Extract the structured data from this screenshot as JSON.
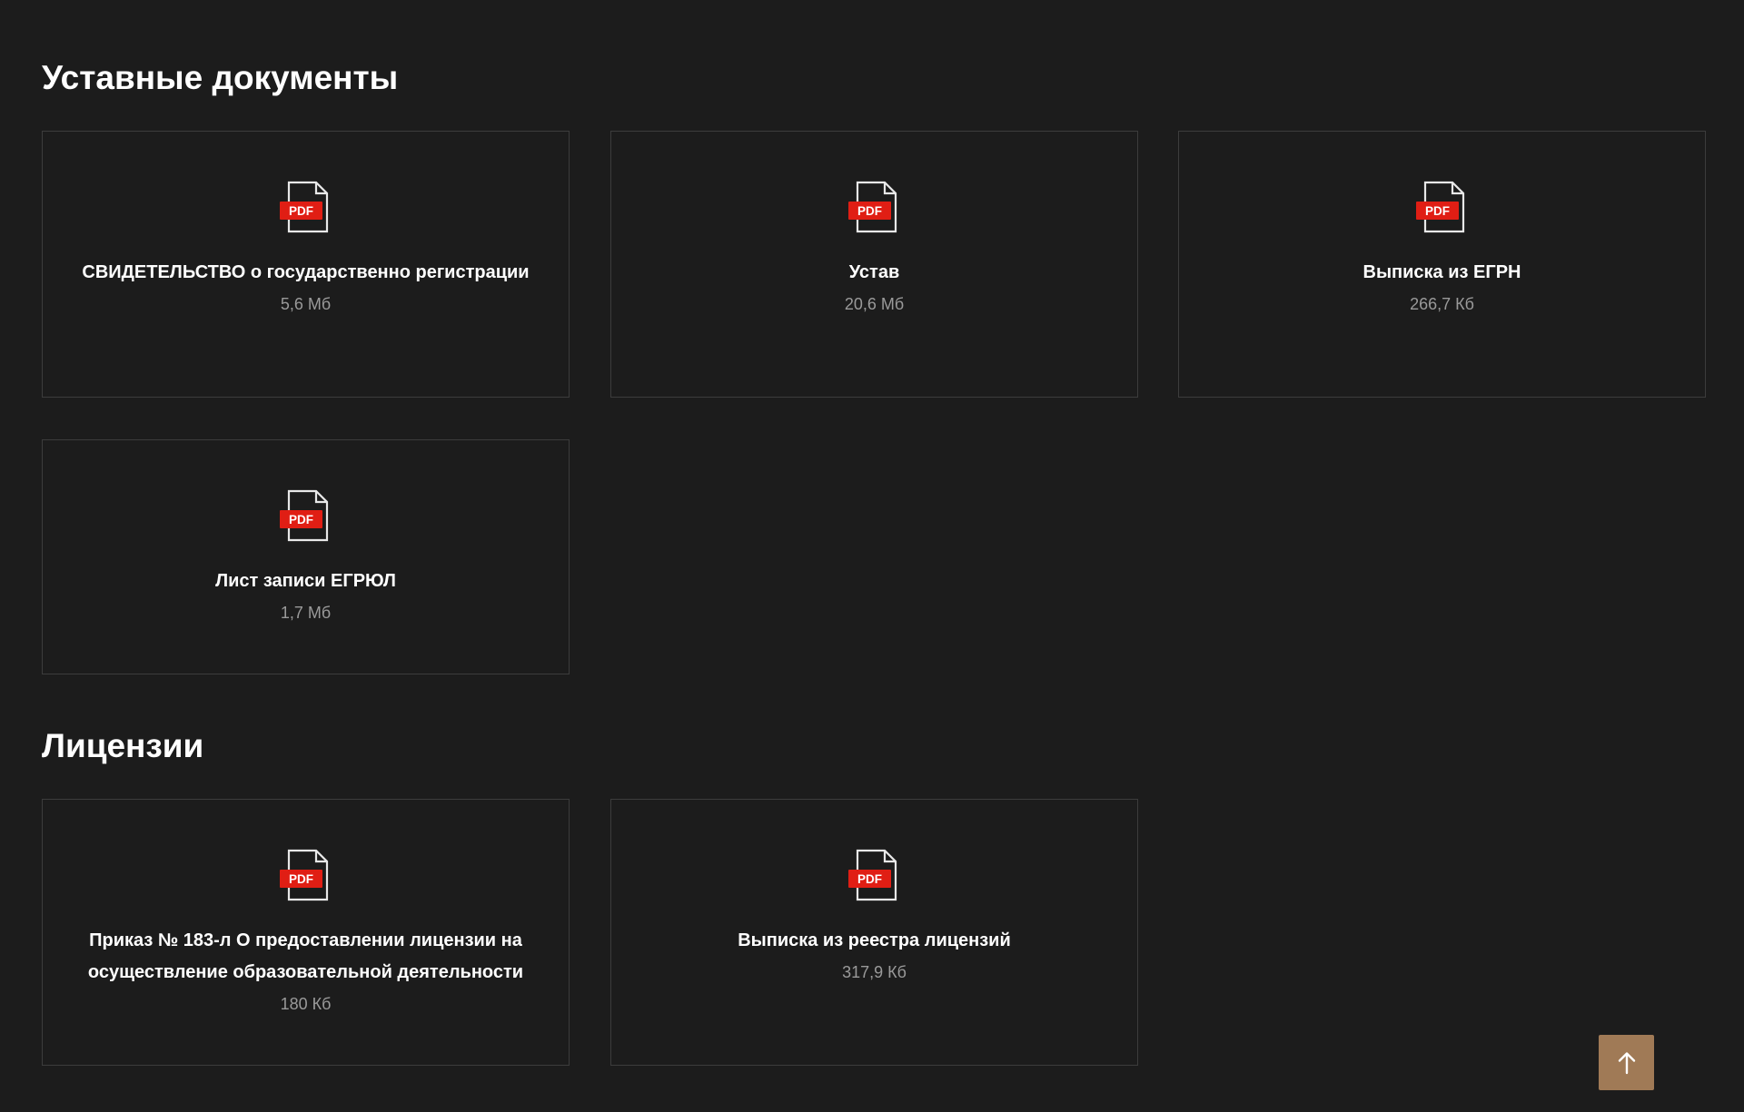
{
  "sections": [
    {
      "title": "Уставные документы",
      "documents": [
        {
          "title": "СВИДЕТЕЛЬСТВО о государственно регистрации",
          "size": "5,6 Мб",
          "icon": "pdf-file-icon"
        },
        {
          "title": "Устав",
          "size": "20,6 Мб",
          "icon": "pdf-file-icon"
        },
        {
          "title": "Выписка из ЕГРН",
          "size": "266,7 Кб",
          "icon": "pdf-file-icon"
        },
        {
          "title": "Лист записи ЕГРЮЛ",
          "size": "1,7 Мб",
          "icon": "pdf-file-icon"
        }
      ]
    },
    {
      "title": "Лицензии",
      "documents": [
        {
          "title": "Приказ № 183-л О предоставлении лицензии на осуществление образовательной деятельности",
          "size": "180 Кб",
          "icon": "pdf-file-icon"
        },
        {
          "title": "Выписка из реестра лицензий",
          "size": "317,9 Кб",
          "icon": "pdf-file-icon"
        }
      ]
    }
  ],
  "pdf_badge_label": "PDF",
  "scroll_top_icon": "arrow-up-icon",
  "colors": {
    "background": "#1c1c1c",
    "card_border": "#3c3c3c",
    "pdf_badge": "#e01e14",
    "size_text": "#9a9a9a",
    "scroll_top_button": "#a07a56"
  }
}
